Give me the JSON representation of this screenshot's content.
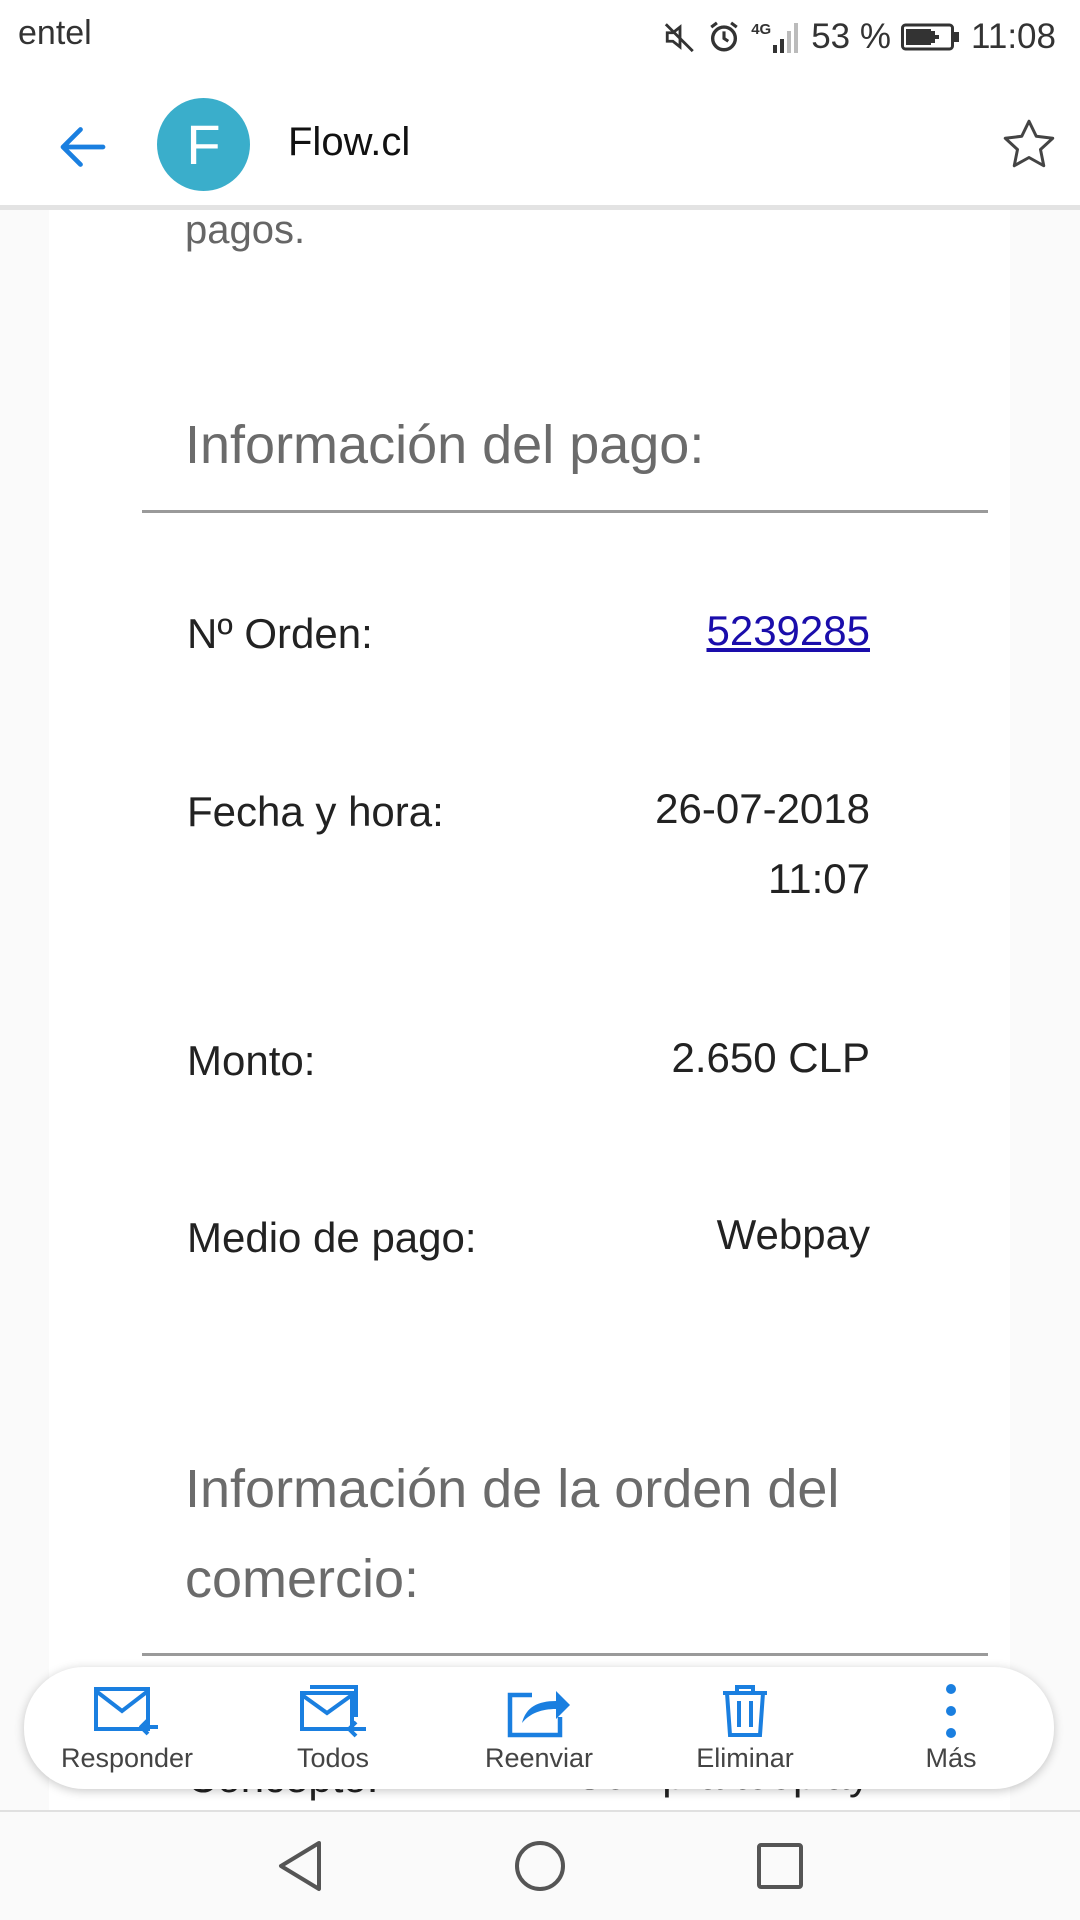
{
  "status_bar": {
    "carrier": "entel",
    "network": "4G",
    "battery": "53 %",
    "time": "11:08"
  },
  "header": {
    "avatar_letter": "F",
    "sender": "Flow.cl"
  },
  "email": {
    "intro_tail": "pagos.",
    "payment_section_title": "Información del pago:",
    "rows": [
      {
        "label": "Nº Orden:",
        "value": "5239285"
      },
      {
        "label": "Fecha y hora:",
        "value_line1": "26-07-2018",
        "value_line2": "11:07"
      },
      {
        "label": "Monto:",
        "value": "2.650 CLP"
      },
      {
        "label": "Medio de pago:",
        "value": "Webpay"
      }
    ],
    "order_section_title_line1": "Información de la orden del",
    "order_section_title_line2": "comercio:",
    "next_row_label": "Concepto:",
    "next_row_value": "Compra tooplay"
  },
  "actions": [
    {
      "label": "Responder",
      "icon": "reply-icon"
    },
    {
      "label": "Todos",
      "icon": "reply-all-icon"
    },
    {
      "label": "Reenviar",
      "icon": "forward-icon"
    },
    {
      "label": "Eliminar",
      "icon": "trash-icon"
    },
    {
      "label": "Más",
      "icon": "more-vertical-icon"
    }
  ],
  "colors": {
    "accent": "#1a7fe0",
    "avatar": "#3aaecb",
    "link": "#1a0dab"
  }
}
